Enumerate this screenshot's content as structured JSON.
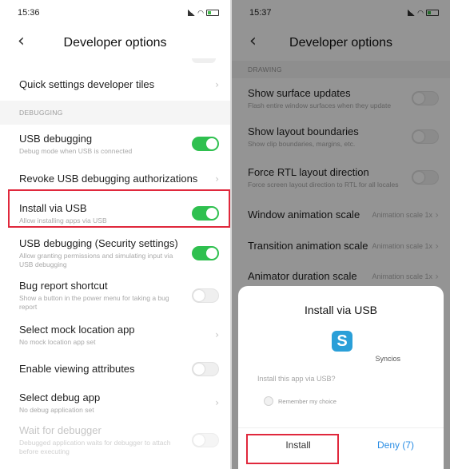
{
  "left": {
    "status": {
      "time": "15:36"
    },
    "title": "Developer options",
    "rows_top": [
      {
        "title": "Quick settings developer tiles",
        "subtitle": "",
        "control": "chevron"
      }
    ],
    "section_debugging": "DEBUGGING",
    "rows": [
      {
        "title": "USB debugging",
        "subtitle": "Debug mode when USB is connected",
        "control": "toggle-on"
      },
      {
        "title": "Revoke USB debugging authorizations",
        "subtitle": "",
        "control": "chevron"
      },
      {
        "title": "Install via USB",
        "subtitle": "Allow installing apps via USB",
        "control": "toggle-on"
      },
      {
        "title": "USB debugging (Security settings)",
        "subtitle": "Allow granting permissions and simulating input via USB debugging",
        "control": "toggle-on"
      },
      {
        "title": "Bug report shortcut",
        "subtitle": "Show a button in the power menu for taking a bug report",
        "control": "toggle-off"
      },
      {
        "title": "Select mock location app",
        "subtitle": "No mock location app set",
        "control": "chevron"
      },
      {
        "title": "Enable viewing attributes",
        "subtitle": "",
        "control": "toggle-off"
      },
      {
        "title": "Select debug app",
        "subtitle": "No debug application set",
        "control": "chevron"
      },
      {
        "title": "Wait for debugger",
        "subtitle": "Debugged application waits for debugger to attach before executing",
        "control": "toggle-off-disabled"
      }
    ]
  },
  "right": {
    "status": {
      "time": "15:37"
    },
    "title": "Developer options",
    "section_drawing": "DRAWING",
    "rows": [
      {
        "title": "Show surface updates",
        "subtitle": "Flash entire window surfaces when they update",
        "value": ""
      },
      {
        "title": "Show layout boundaries",
        "subtitle": "Show clip boundaries, margins, etc.",
        "value": ""
      },
      {
        "title": "Force RTL layout direction",
        "subtitle": "Force screen layout direction to RTL for all locales",
        "value": ""
      },
      {
        "title": "Window animation scale",
        "subtitle": "",
        "value": "Animation scale 1x"
      },
      {
        "title": "Transition animation scale",
        "subtitle": "",
        "value": "Animation scale 1x"
      },
      {
        "title": "Animator duration scale",
        "subtitle": "",
        "value": "Animation scale 1x"
      }
    ],
    "dialog": {
      "title": "Install via USB",
      "app_icon_letter": "S",
      "app_name": "Syncios",
      "question": "Install this app via USB?",
      "remember_label": "Remember my choice",
      "install_label": "Install",
      "deny_label": "Deny (7)"
    }
  },
  "colors": {
    "toggle_on": "#2fc04f",
    "highlight": "#e0283c",
    "deny": "#2a8de4",
    "app_icon": "#2a9fd8"
  },
  "icons": {
    "back": "chevron-left-icon",
    "row_arrow": "chevron-right-icon"
  }
}
